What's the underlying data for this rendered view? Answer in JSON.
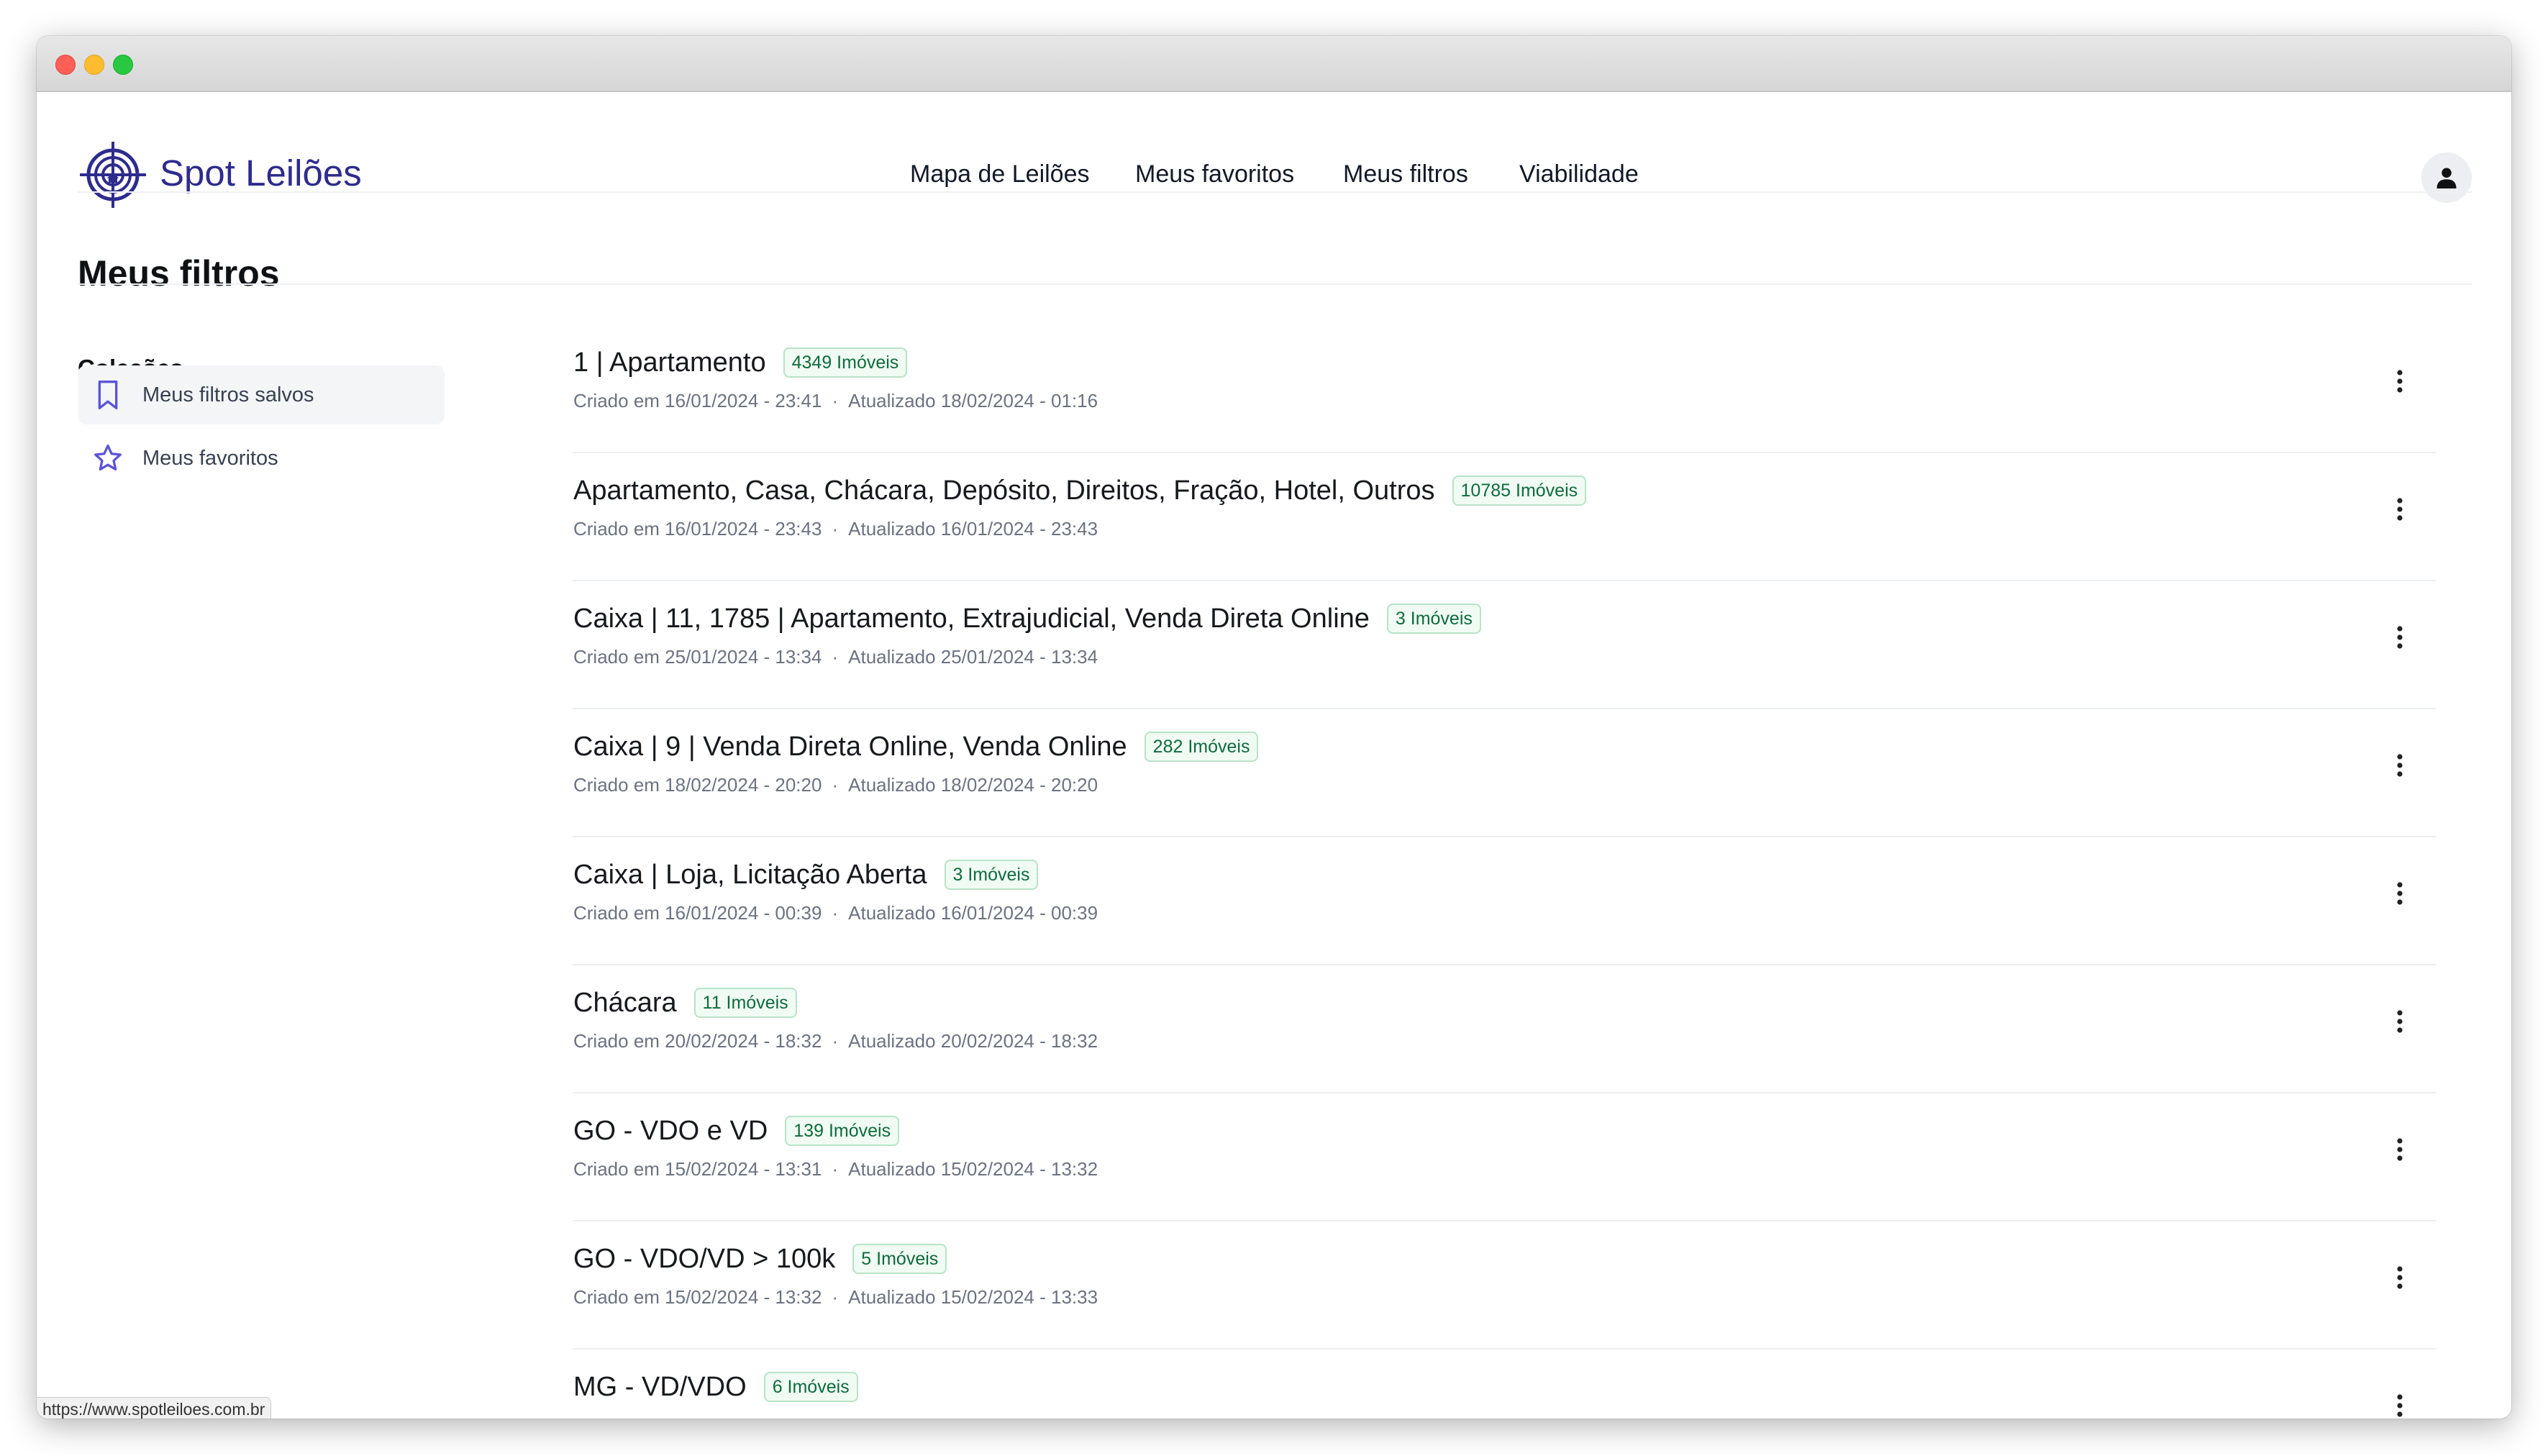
{
  "app": {
    "brand": "Spot Leilões",
    "status_url": "https://www.spotleiloes.com.br"
  },
  "nav": {
    "links": [
      "Mapa de Leilões",
      "Meus favoritos",
      "Meus filtros",
      "Viabilidade"
    ]
  },
  "page": {
    "title": "Meus filtros"
  },
  "sidebar": {
    "title": "Coleções",
    "items": [
      {
        "label": "Meus filtros salvos",
        "icon": "bookmark-icon",
        "active": true
      },
      {
        "label": "Meus favoritos",
        "icon": "star-icon",
        "active": false
      }
    ]
  },
  "filters": [
    {
      "title": "1 | Apartamento",
      "badge": "4349 Imóveis",
      "created": "Criado em 16/01/2024 - 23:41",
      "updated": "Atualizado  18/02/2024 - 01:16"
    },
    {
      "title": "Apartamento, Casa, Chácara, Depósito, Direitos, Fração, Hotel, Outros",
      "badge": "10785 Imóveis",
      "created": "Criado em 16/01/2024 - 23:43",
      "updated": "Atualizado  16/01/2024 - 23:43"
    },
    {
      "title": "Caixa | 11, 1785 | Apartamento, Extrajudicial, Venda Direta Online",
      "badge": "3 Imóveis",
      "created": "Criado em 25/01/2024 - 13:34",
      "updated": "Atualizado  25/01/2024 - 13:34"
    },
    {
      "title": "Caixa | 9 | Venda Direta Online, Venda Online",
      "badge": "282 Imóveis",
      "created": "Criado em 18/02/2024 - 20:20",
      "updated": "Atualizado  18/02/2024 - 20:20"
    },
    {
      "title": "Caixa | Loja, Licitação Aberta",
      "badge": "3 Imóveis",
      "created": "Criado em 16/01/2024 - 00:39",
      "updated": "Atualizado  16/01/2024 - 00:39"
    },
    {
      "title": "Chácara",
      "badge": "11 Imóveis",
      "created": "Criado em 20/02/2024 - 18:32",
      "updated": "Atualizado  20/02/2024 - 18:32"
    },
    {
      "title": "GO - VDO e VD",
      "badge": "139 Imóveis",
      "created": "Criado em 15/02/2024 - 13:31",
      "updated": "Atualizado  15/02/2024 - 13:32"
    },
    {
      "title": "GO - VDO/VD > 100k",
      "badge": "5 Imóveis",
      "created": "Criado em 15/02/2024 - 13:32",
      "updated": "Atualizado  15/02/2024 - 13:33"
    },
    {
      "title": "MG - VD/VDO",
      "badge": "6 Imóveis",
      "created": "",
      "updated": ""
    }
  ],
  "colors": {
    "brand": "#2e2b8e",
    "accent_icon": "#5b54d6",
    "badge_text": "#0f6b3b",
    "badge_bg": "#f0fbf4",
    "badge_border": "#b7e3c7"
  }
}
